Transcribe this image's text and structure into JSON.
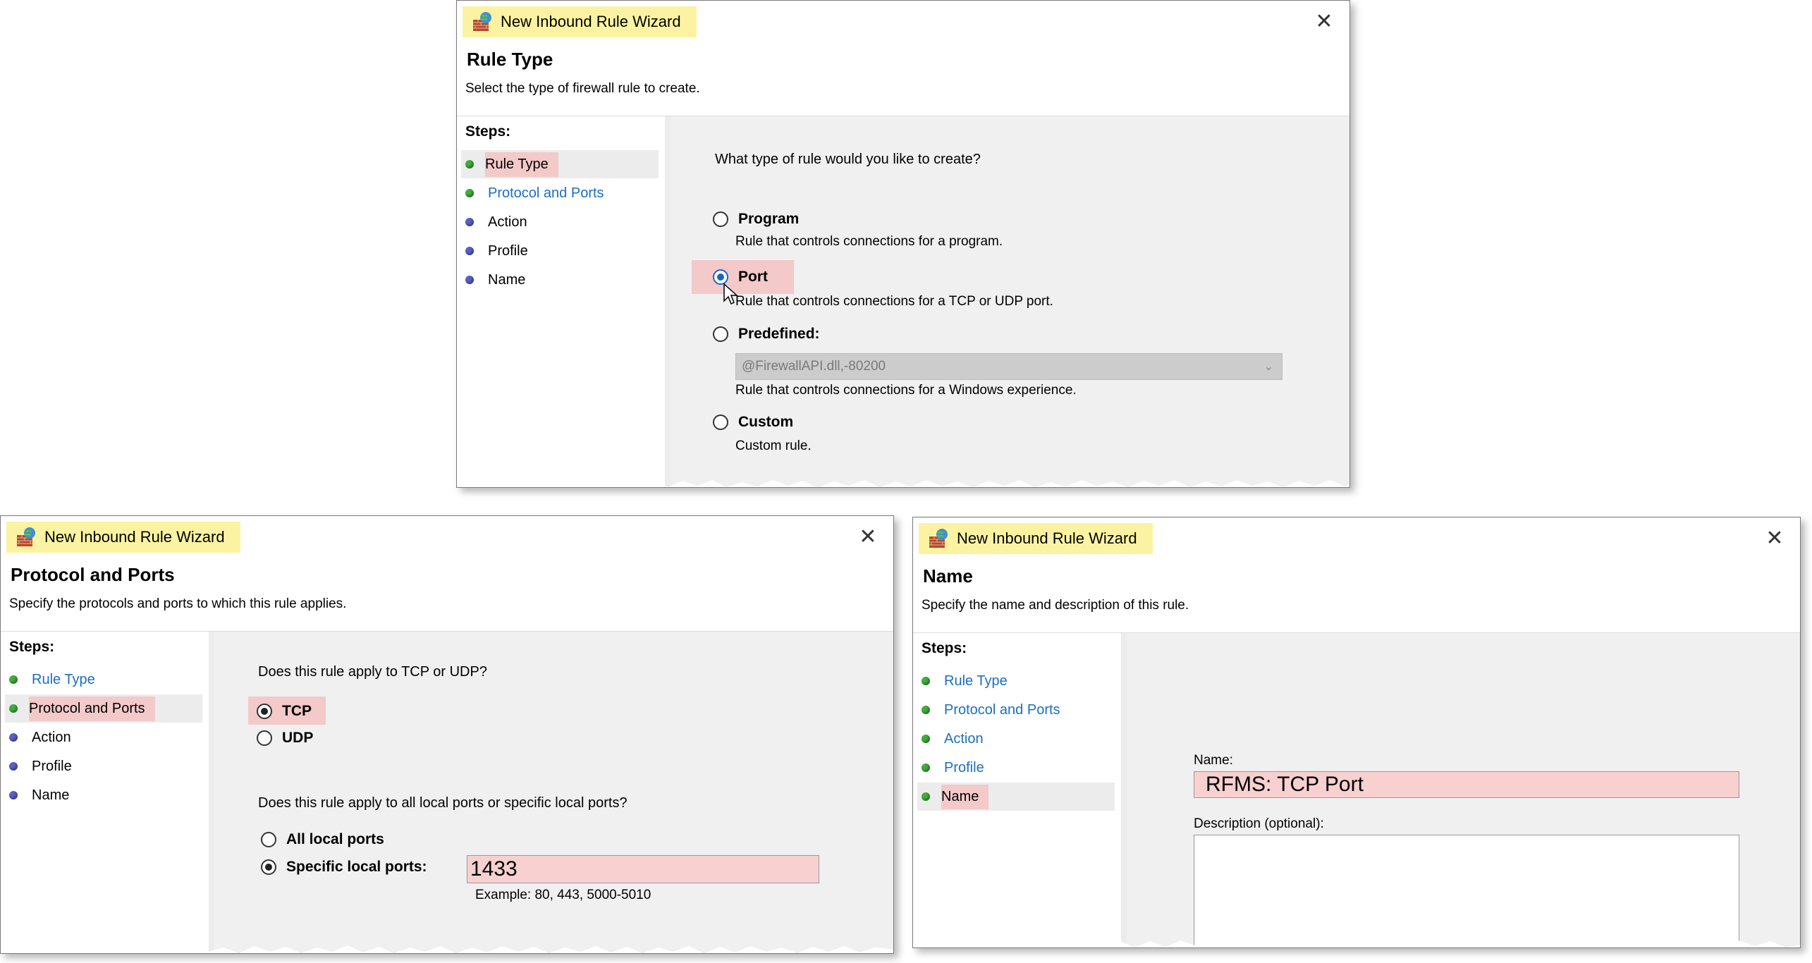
{
  "dialogs": {
    "rule_type": {
      "title": "New Inbound Rule Wizard",
      "header_title": "Rule Type",
      "header_subtitle": "Select the type of firewall rule to create.",
      "steps_title": "Steps:",
      "steps": [
        "Rule Type",
        "Protocol and Ports",
        "Action",
        "Profile",
        "Name"
      ],
      "question": "What type of rule would you like to create?",
      "options": {
        "program": {
          "label": "Program",
          "desc": "Rule that controls connections for a program."
        },
        "port": {
          "label": "Port",
          "desc": "Rule that controls connections for a TCP or UDP port."
        },
        "predefined": {
          "label": "Predefined:",
          "select_value": "@FirewallAPI.dll,-80200",
          "desc": "Rule that controls connections for a Windows experience."
        },
        "custom": {
          "label": "Custom",
          "desc": "Custom rule."
        }
      },
      "selected": "Port"
    },
    "protocol_ports": {
      "title": "New Inbound Rule Wizard",
      "header_title": "Protocol and Ports",
      "header_subtitle": "Specify the protocols and ports to which this rule applies.",
      "steps_title": "Steps:",
      "steps": [
        "Rule Type",
        "Protocol and Ports",
        "Action",
        "Profile",
        "Name"
      ],
      "question_protocol": "Does this rule apply to TCP or UDP?",
      "tcp_label": "TCP",
      "udp_label": "UDP",
      "question_ports": "Does this rule apply to all local ports or specific local ports?",
      "all_ports_label": "All local ports",
      "specific_ports_label": "Specific local ports:",
      "ports_value": "1433",
      "ports_example": "Example: 80, 443, 5000-5010"
    },
    "name": {
      "title": "New Inbound Rule Wizard",
      "header_title": "Name",
      "header_subtitle": "Specify the name and description of this rule.",
      "steps_title": "Steps:",
      "steps": [
        "Rule Type",
        "Protocol and Ports",
        "Action",
        "Profile",
        "Name"
      ],
      "name_label": "Name:",
      "name_value": "RFMS: TCP Port",
      "description_label": "Description (optional):",
      "description_value": ""
    }
  },
  "colors": {
    "title_highlight": "#fbf3a1",
    "selection_highlight": "#f3c9c9",
    "link_blue": "#1b6fc0",
    "step_done": "#3fae3a",
    "step_pending": "#5a5fc8"
  }
}
